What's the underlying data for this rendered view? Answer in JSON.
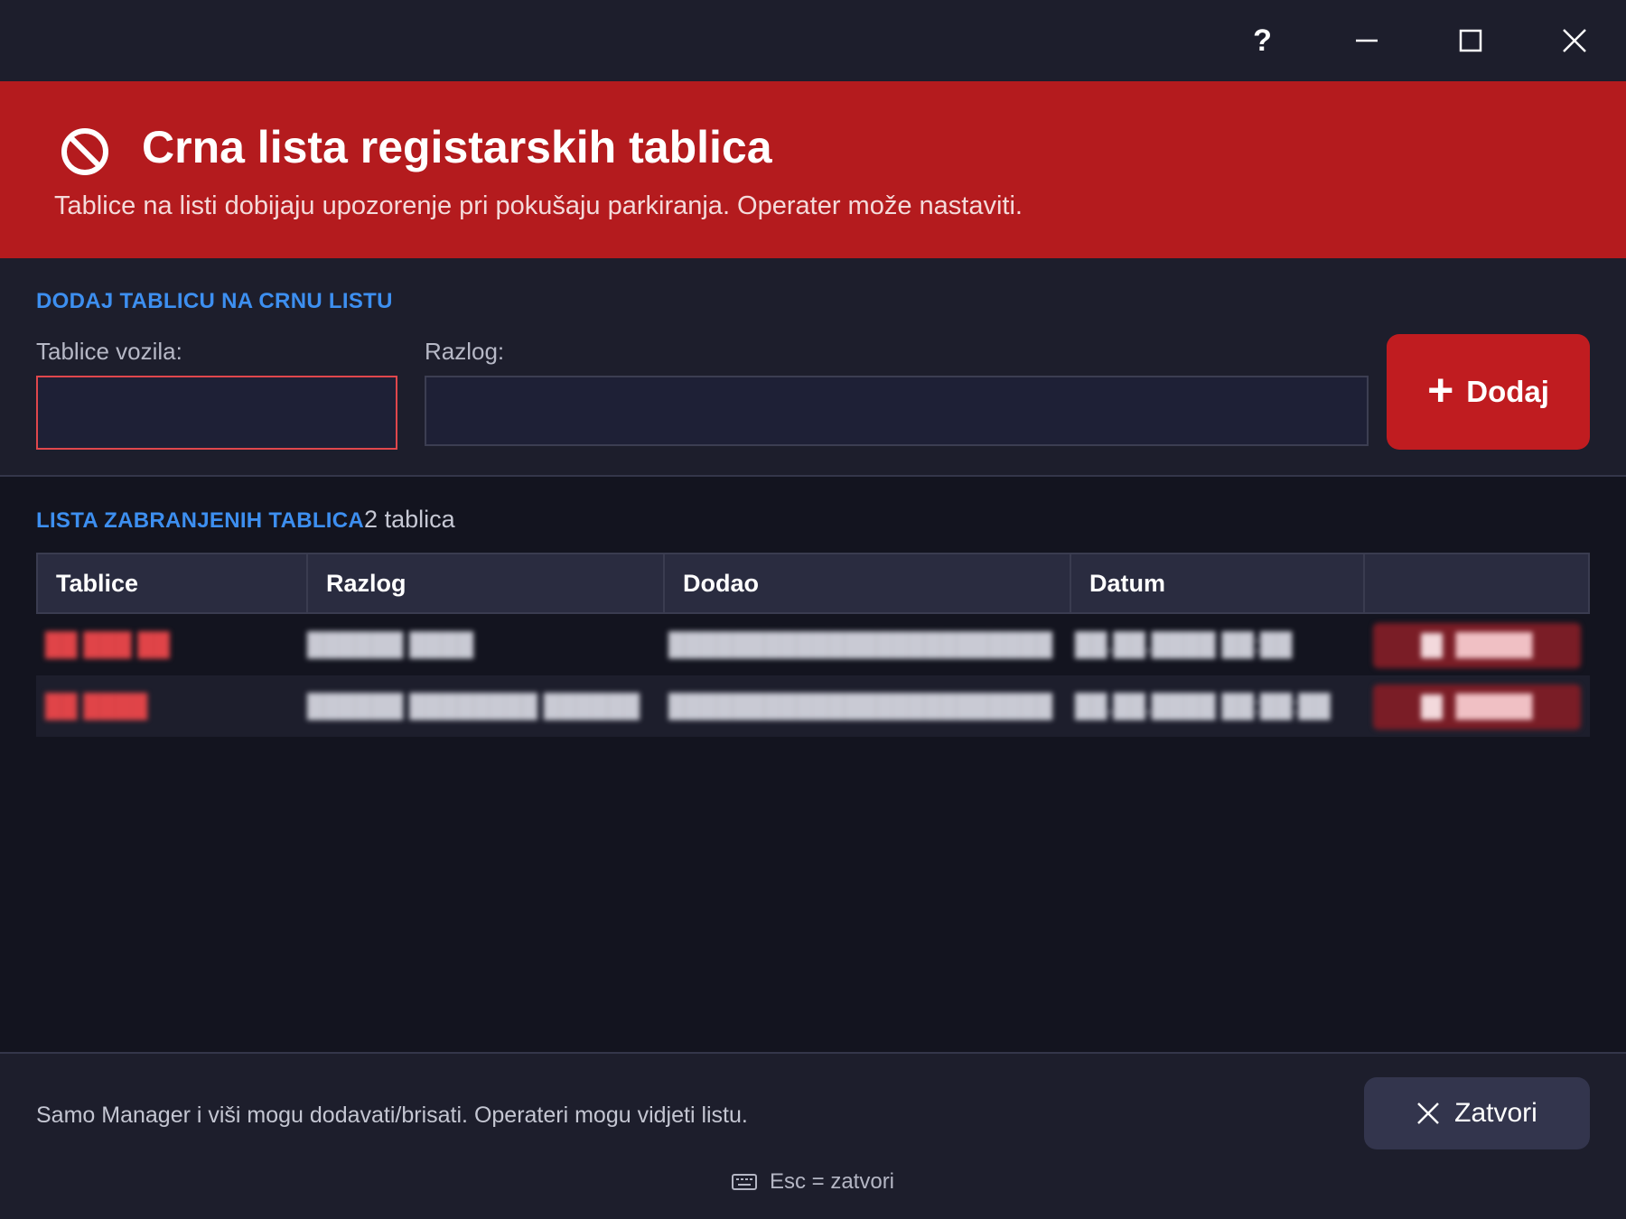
{
  "window": {
    "help_label": "?",
    "minimize_icon": "minimize-icon",
    "maximize_icon": "maximize-icon",
    "close_icon": "close-icon"
  },
  "header": {
    "icon": "ban-icon",
    "title": "Crna lista registarskih tablica",
    "subtitle": "Tablice na listi dobijaju upozorenje pri pokušaju parkiranja. Operater može nastaviti."
  },
  "add_form": {
    "section_title": "DODAJ TABLICU NA CRNU LISTU",
    "plate_label": "Tablice vozila:",
    "plate_value": "",
    "reason_label": "Razlog:",
    "reason_value": "",
    "add_button_label": "Dodaj",
    "add_button_icon": "plus-icon"
  },
  "list": {
    "section_title": "LISTA ZABRANJENIH TABLICA",
    "count_text": "2 tablica",
    "columns": [
      "Tablice",
      "Razlog",
      "Dodao",
      "Datum",
      ""
    ],
    "rows": [
      {
        "plate": "██ ███ ██",
        "reason": "██████ ████",
        "added_by": "████████████████████████",
        "date": "██.██.████ ██:██",
        "delete_label": "█████"
      },
      {
        "plate": "██ ████",
        "reason": "██████ ████████ ██████",
        "added_by": "████████████████████████",
        "date": "██.██.████ ██:██:██",
        "delete_label": "█████"
      }
    ]
  },
  "footer": {
    "note": "Samo Manager i viši mogu dodavati/brisati. Operateri mogu vidjeti listu.",
    "close_button_label": "Zatvori",
    "shortcut_hint": "Esc = zatvori",
    "keyboard_icon": "keyboard-icon"
  },
  "colors": {
    "accent_red": "#b41b1e",
    "section_blue": "#3d8ff0",
    "background": "#13141f",
    "panel": "#1d1e2c"
  }
}
